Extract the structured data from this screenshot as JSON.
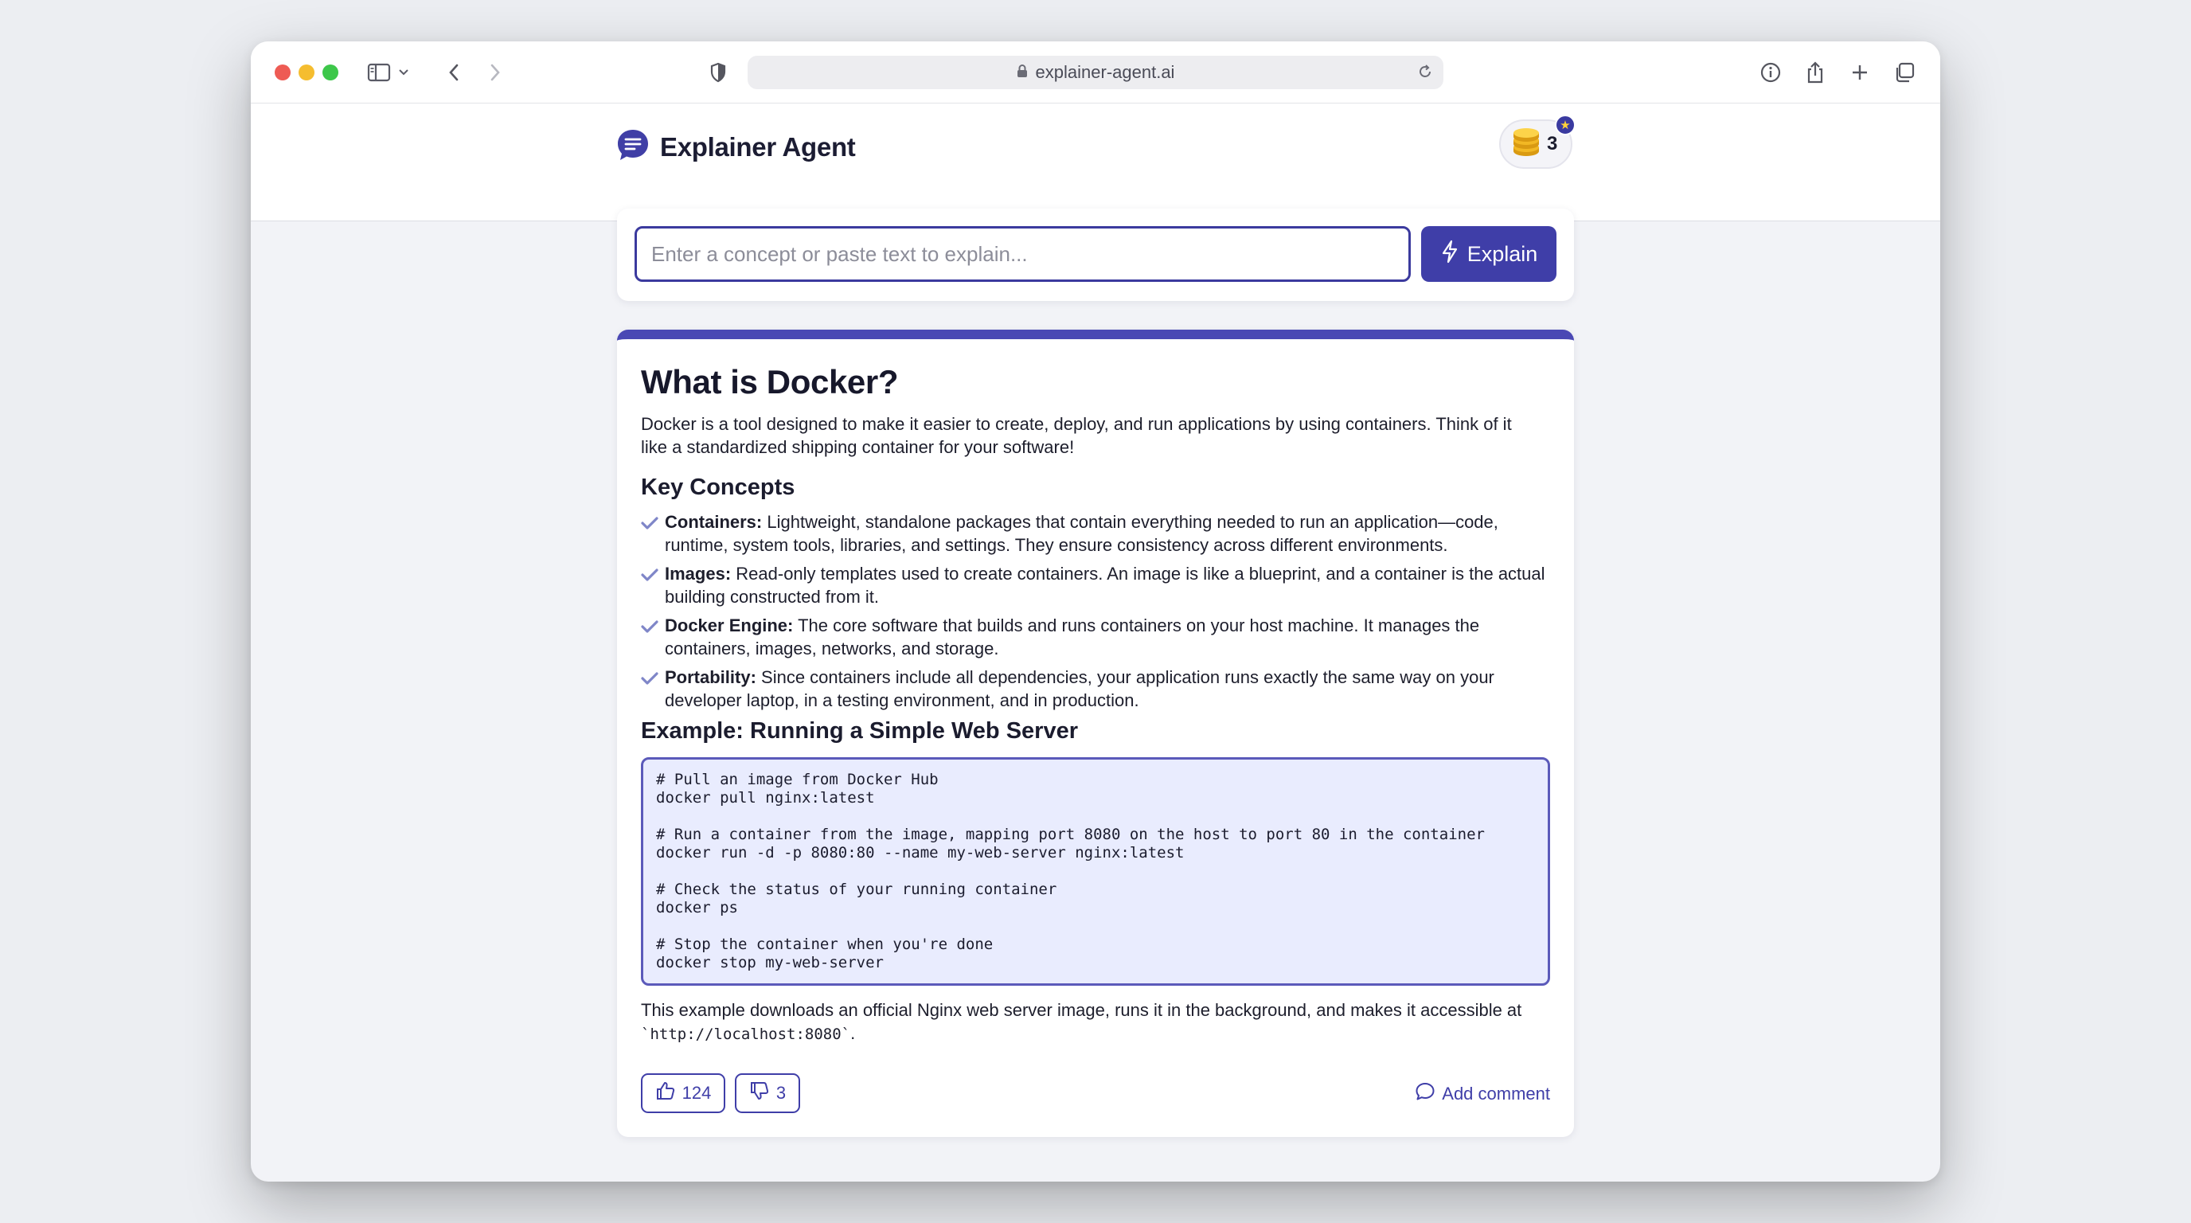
{
  "browser": {
    "url": "explainer-agent.ai"
  },
  "header": {
    "brand_title": "Explainer Agent",
    "coin_count": "3"
  },
  "search": {
    "placeholder": "Enter a concept or paste text to explain...",
    "value": "",
    "button_label": "Explain"
  },
  "explanation": {
    "title": "What is Docker?",
    "intro": "Docker is a tool designed to make it easier to create, deploy, and run applications by using containers. Think of it like a standardized shipping container for your software!",
    "concepts_heading": "Key Concepts",
    "concepts": [
      {
        "term": "Containers:",
        "desc": " Lightweight, standalone packages that contain everything needed to run an application—code, runtime, system tools, libraries, and settings. They ensure consistency across different environments."
      },
      {
        "term": "Images:",
        "desc": " Read-only templates used to create containers. An image is like a blueprint, and a container is the actual building constructed from it."
      },
      {
        "term": "Docker Engine:",
        "desc": " The core software that builds and runs containers on your host machine. It manages the containers, images, networks, and storage."
      },
      {
        "term": "Portability:",
        "desc": " Since containers include all dependencies, your application runs exactly the same way on your developer laptop, in a testing environment, and in production."
      }
    ],
    "example_heading": "Example: Running a Simple Web Server",
    "code": "# Pull an image from Docker Hub\ndocker pull nginx:latest\n\n# Run a container from the image, mapping port 8080 on the host to port 80 in the container\ndocker run -d -p 8080:80 --name my-web-server nginx:latest\n\n# Check the status of your running container\ndocker ps\n\n# Stop the container when you're done\ndocker stop my-web-server",
    "outro_text": "This example downloads an official Nginx web server image, runs it in the background, and makes it accessible at ",
    "outro_code": "`http://localhost:8080`",
    "outro_end": "."
  },
  "feedback": {
    "likes": "124",
    "dislikes": "3",
    "comment_label": "Add comment"
  },
  "colors": {
    "accent": "#3f3ea8",
    "code_bg": "#e9ecfe"
  }
}
